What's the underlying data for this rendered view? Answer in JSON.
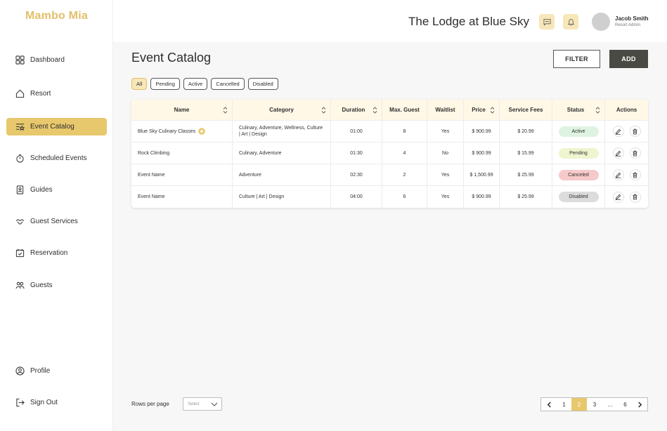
{
  "brand": "Mambo Mia",
  "header": {
    "lodge_name": "The Lodge at Blue Sky",
    "user_name": "Jacob Smith",
    "user_role": "Resort Admin"
  },
  "sidebar": {
    "items": [
      {
        "label": "Dashboard",
        "icon": "grid-icon"
      },
      {
        "label": "Resort",
        "icon": "home-icon"
      },
      {
        "label": "Event Catalog",
        "icon": "list-star-icon",
        "active": true
      },
      {
        "label": "Scheduled Events",
        "icon": "stopwatch-icon"
      },
      {
        "label": "Guides",
        "icon": "id-badge-icon"
      },
      {
        "label": "Guest Services",
        "icon": "handshake-icon"
      },
      {
        "label": "Reservation",
        "icon": "calendar-check-icon"
      },
      {
        "label": "Guests",
        "icon": "people-icon"
      },
      {
        "label": "Profile",
        "icon": "user-circle-icon"
      },
      {
        "label": "Sign Out",
        "icon": "sign-out-icon"
      }
    ]
  },
  "main": {
    "title": "Event Catalog",
    "filter_label": "FILTER",
    "add_label": "ADD",
    "chips": [
      "All",
      "Pending",
      "Active",
      "Cancelled",
      "Disabled"
    ],
    "table": {
      "columns": [
        "Name",
        "Category",
        "Duration",
        "Max. Guest",
        "Waitlist",
        "Price",
        "Service Fees",
        "Status",
        "Actions"
      ],
      "rows": [
        {
          "name": "Blue Sky Culinary Classes",
          "category": "Culinary, Adventure, Wellness, Culture | Art | Design",
          "duration": "01:00",
          "max_guest": "8",
          "waitlist": "Yes",
          "price": "$ 900.99",
          "fees": "$ 20.99",
          "status": "Active"
        },
        {
          "name": "Rock Climbing",
          "category": "Culinary, Adventure",
          "duration": "01:30",
          "max_guest": "4",
          "waitlist": "No",
          "price": "$ 900.99",
          "fees": "$ 15.99",
          "status": "Pending"
        },
        {
          "name": "Event Name",
          "category": "Adventure",
          "duration": "02:30",
          "max_guest": "2",
          "waitlist": "Yes",
          "price": "$ 1,500.99",
          "fees": "$ 25.99",
          "status": "Canceled"
        },
        {
          "name": "Event Name",
          "category": "Culture | Art | Design",
          "duration": "04:00",
          "max_guest": "6",
          "waitlist": "Yes",
          "price": "$ 900.99",
          "fees": "$ 25.99",
          "status": "Disabled"
        }
      ]
    }
  },
  "footer": {
    "rows_per_page_label": "Rows per page",
    "select_placeholder": "Select",
    "pages": [
      "1",
      "2",
      "3",
      "…",
      "6"
    ],
    "current_page": "2"
  },
  "colors": {
    "accent": "#e8c86c",
    "brand": "#e2c06a",
    "active_bg": "#dff3e3",
    "pending_bg": "#eef5cf",
    "canceled_bg": "#f6c9ca",
    "disabled_bg": "#dcdcdc"
  }
}
